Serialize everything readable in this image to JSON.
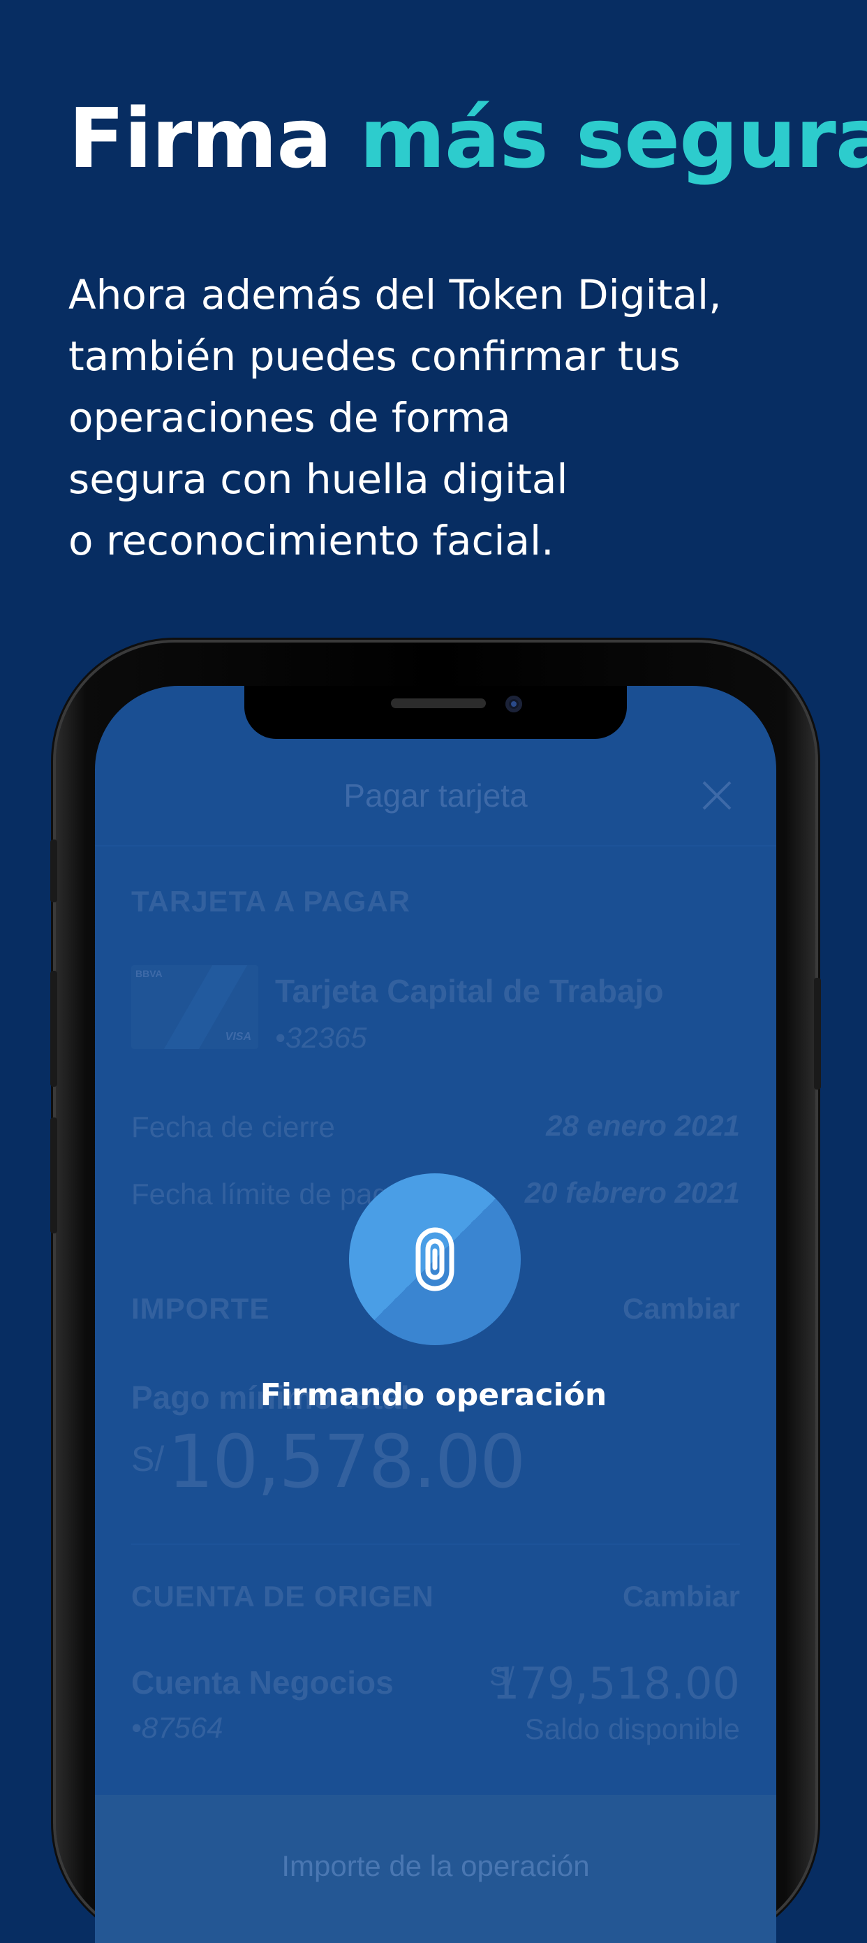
{
  "header": {
    "title_part1": "Firma",
    "title_part2": "más segura",
    "subtitle_lines": [
      "Ahora además del Token Digital,",
      "también puedes confirmar tus",
      "operaciones de forma",
      "segura con huella digital",
      "o reconocimiento facial."
    ]
  },
  "app": {
    "nav_title": "Pagar tarjeta",
    "card_section_title": "TARJETA A PAGAR",
    "card_brand": "BBVA",
    "card_network": "VISA",
    "card_name": "Tarjeta Capital de Trabajo",
    "card_number": "•32365",
    "closing_label": "Fecha de cierre",
    "closing_value": "28 enero 2021",
    "due_label": "Fecha límite de pago",
    "due_value": "20 febrero 2021",
    "amount_section_title": "IMPORTE",
    "change_label": "Cambiar",
    "payment_type": "Pago mínimo total",
    "currency_symbol": "S/",
    "amount": "10,578.00",
    "origin_section_title": "CUENTA DE ORIGEN",
    "origin_change_label": "Cambiar",
    "account_name": "Cuenta Negocios",
    "account_number": "•87564",
    "balance": "179,518.00",
    "balance_label": "Saldo disponible",
    "bottom_label": "Importe de la operación"
  },
  "overlay": {
    "status_text": "Firmando operación",
    "icon": "fingerprint-icon"
  },
  "colors": {
    "background": "#072d62",
    "accent": "#2dcccd",
    "screen": "#1a4f93",
    "fingerprint_circle": "#4a9ee6"
  }
}
